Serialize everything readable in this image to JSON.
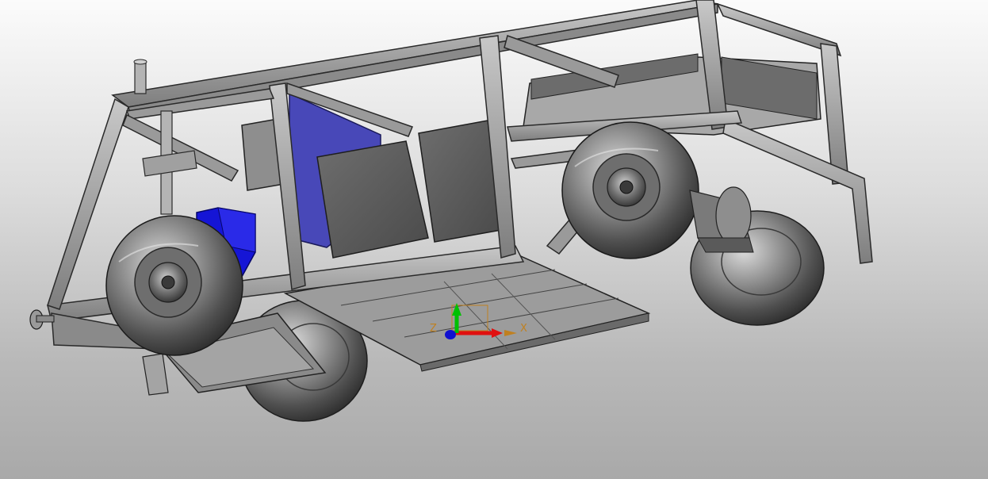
{
  "viewport": {
    "background_top": "#fbfbfb",
    "background_bottom": "#a9a9a9"
  },
  "model": {
    "frame_color": "#8e8e8e",
    "frame_edge_color": "#2a2a2a",
    "panel_color": "#5a5a5a",
    "blue_part_color": "#1515d6",
    "blue_panel_color": "#4848b8",
    "wheel_color": "#6a6a6a"
  },
  "triad": {
    "x_label": "X",
    "y_label": "Y",
    "z_label": "Z",
    "x_color": "#e01010",
    "y_color": "#00c000",
    "z_color": "#1010d0",
    "label_color": "#c08020"
  }
}
